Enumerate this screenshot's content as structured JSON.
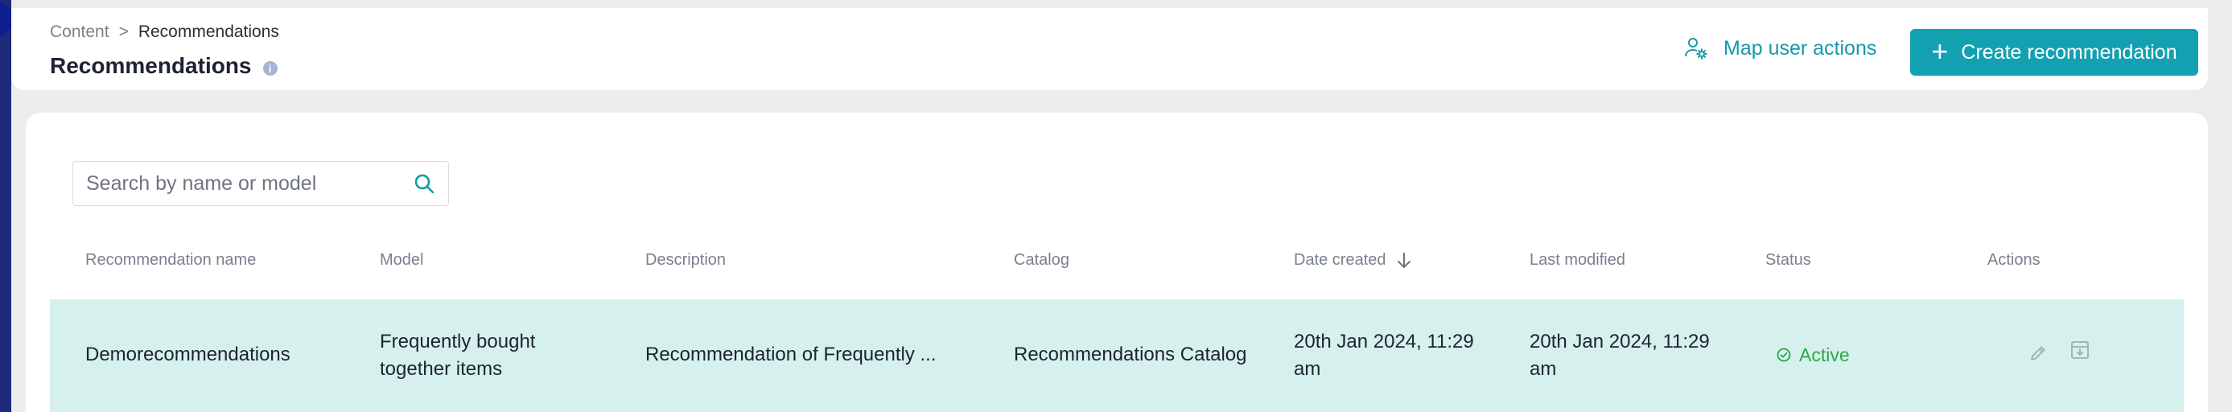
{
  "breadcrumb": {
    "parent": "Content",
    "separator": ">",
    "current": "Recommendations"
  },
  "page": {
    "title": "Recommendations",
    "info_icon": "i"
  },
  "header_actions": {
    "map_label": "Map user actions",
    "map_icon": "user-gear-icon",
    "create_label": "Create recommendation",
    "create_icon": "+"
  },
  "search": {
    "placeholder": "Search by name or model",
    "value": ""
  },
  "table": {
    "columns": {
      "name": "Recommendation name",
      "model": "Model",
      "description": "Description",
      "catalog": "Catalog",
      "date_created": "Date created",
      "last_modified": "Last modified",
      "status": "Status",
      "actions": "Actions"
    },
    "sort": {
      "column": "Date created",
      "direction": "descending"
    },
    "rows": [
      {
        "name": "Demorecommendations",
        "model_line1": "Frequently bought",
        "model_line2": "together items",
        "description": "Recommendation of Frequently ...",
        "catalog": "Recommendations Catalog",
        "date_created_line1": "20th Jan 2024, 11:29",
        "date_created_line2": "am",
        "last_modified_line1": "20th Jan 2024, 11:29",
        "last_modified_line2": "am",
        "status": "Active"
      }
    ]
  },
  "colors": {
    "accent": "#13a0b0",
    "row_highlight": "#d6f1ed",
    "status_active": "#2aa84a",
    "rail": "#1f2a7a"
  }
}
